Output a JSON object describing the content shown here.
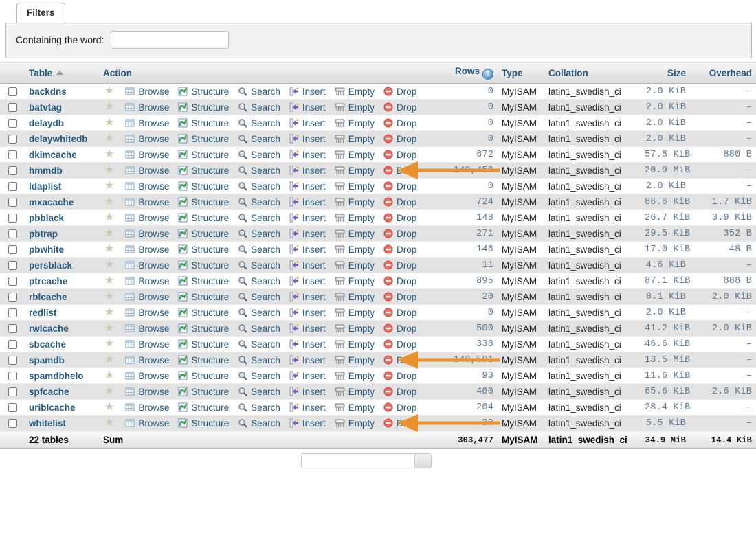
{
  "filters": {
    "tab_label": "Filters",
    "containing_label": "Containing the word:",
    "containing_value": "",
    "containing_placeholder": ""
  },
  "columns": {
    "table": "Table",
    "action": "Action",
    "rows": "Rows",
    "rows_help_icon": "help-icon",
    "type": "Type",
    "collation": "Collation",
    "size": "Size",
    "overhead": "Overhead"
  },
  "actions": {
    "favorite_icon": "star-icon",
    "browse": "Browse",
    "structure": "Structure",
    "search": "Search",
    "insert": "Insert",
    "empty": "Empty",
    "drop": "Drop"
  },
  "colors": {
    "link": "#235a81",
    "arrow": "#e8912d",
    "row_alt": "#e3e3e3",
    "header_text": "#235a81",
    "numeric": "#5c7a94"
  },
  "rows": [
    {
      "name": "backdns",
      "rows": "0",
      "type": "MyISAM",
      "collation": "latin1_swedish_ci",
      "size": "2.0 KiB",
      "overhead": "–"
    },
    {
      "name": "batvtag",
      "rows": "0",
      "type": "MyISAM",
      "collation": "latin1_swedish_ci",
      "size": "2.0 KiB",
      "overhead": "–"
    },
    {
      "name": "delaydb",
      "rows": "0",
      "type": "MyISAM",
      "collation": "latin1_swedish_ci",
      "size": "2.0 KiB",
      "overhead": "–"
    },
    {
      "name": "delaywhitedb",
      "rows": "0",
      "type": "MyISAM",
      "collation": "latin1_swedish_ci",
      "size": "2.0 KiB",
      "overhead": "–"
    },
    {
      "name": "dkimcache",
      "rows": "672",
      "type": "MyISAM",
      "collation": "latin1_swedish_ci",
      "size": "57.8 KiB",
      "overhead": "880 B"
    },
    {
      "name": "hmmdb",
      "rows": "149,459",
      "type": "MyISAM",
      "collation": "latin1_swedish_ci",
      "size": "20.9 MiB",
      "overhead": "–",
      "annotated": true
    },
    {
      "name": "ldaplist",
      "rows": "0",
      "type": "MyISAM",
      "collation": "latin1_swedish_ci",
      "size": "2.0 KiB",
      "overhead": "–"
    },
    {
      "name": "mxacache",
      "rows": "724",
      "type": "MyISAM",
      "collation": "latin1_swedish_ci",
      "size": "86.6 KiB",
      "overhead": "1.7 KiB"
    },
    {
      "name": "pbblack",
      "rows": "148",
      "type": "MyISAM",
      "collation": "latin1_swedish_ci",
      "size": "26.7 KiB",
      "overhead": "3.9 KiB"
    },
    {
      "name": "pbtrap",
      "rows": "271",
      "type": "MyISAM",
      "collation": "latin1_swedish_ci",
      "size": "29.5 KiB",
      "overhead": "352 B"
    },
    {
      "name": "pbwhite",
      "rows": "146",
      "type": "MyISAM",
      "collation": "latin1_swedish_ci",
      "size": "17.0 KiB",
      "overhead": "48 B"
    },
    {
      "name": "persblack",
      "rows": "11",
      "type": "MyISAM",
      "collation": "latin1_swedish_ci",
      "size": "4.6 KiB",
      "overhead": "–"
    },
    {
      "name": "ptrcache",
      "rows": "895",
      "type": "MyISAM",
      "collation": "latin1_swedish_ci",
      "size": "87.1 KiB",
      "overhead": "888 B"
    },
    {
      "name": "rblcache",
      "rows": "20",
      "type": "MyISAM",
      "collation": "latin1_swedish_ci",
      "size": "8.1 KiB",
      "overhead": "2.0 KiB"
    },
    {
      "name": "redlist",
      "rows": "0",
      "type": "MyISAM",
      "collation": "latin1_swedish_ci",
      "size": "2.0 KiB",
      "overhead": "–"
    },
    {
      "name": "rwlcache",
      "rows": "500",
      "type": "MyISAM",
      "collation": "latin1_swedish_ci",
      "size": "41.2 KiB",
      "overhead": "2.0 KiB"
    },
    {
      "name": "sbcache",
      "rows": "338",
      "type": "MyISAM",
      "collation": "latin1_swedish_ci",
      "size": "46.6 KiB",
      "overhead": "–"
    },
    {
      "name": "spamdb",
      "rows": "149,591",
      "type": "MyISAM",
      "collation": "latin1_swedish_ci",
      "size": "13.5 MiB",
      "overhead": "–",
      "annotated": true
    },
    {
      "name": "spamdbhelo",
      "rows": "93",
      "type": "MyISAM",
      "collation": "latin1_swedish_ci",
      "size": "11.6 KiB",
      "overhead": "–"
    },
    {
      "name": "spfcache",
      "rows": "400",
      "type": "MyISAM",
      "collation": "latin1_swedish_ci",
      "size": "65.6 KiB",
      "overhead": "2.6 KiB"
    },
    {
      "name": "uriblcache",
      "rows": "204",
      "type": "MyISAM",
      "collation": "latin1_swedish_ci",
      "size": "28.4 KiB",
      "overhead": "–"
    },
    {
      "name": "whitelist",
      "rows": "20",
      "type": "MyISAM",
      "collation": "latin1_swedish_ci",
      "size": "5.5 KiB",
      "overhead": "–",
      "annotated": true
    }
  ],
  "summary": {
    "table_count": "22 tables",
    "sum_label": "Sum",
    "rows": "303,477",
    "type": "MyISAM",
    "collation": "latin1_swedish_ci",
    "size": "34.9 MiB",
    "overhead": "14.4 KiB"
  },
  "bottom": {
    "select_value": ""
  }
}
